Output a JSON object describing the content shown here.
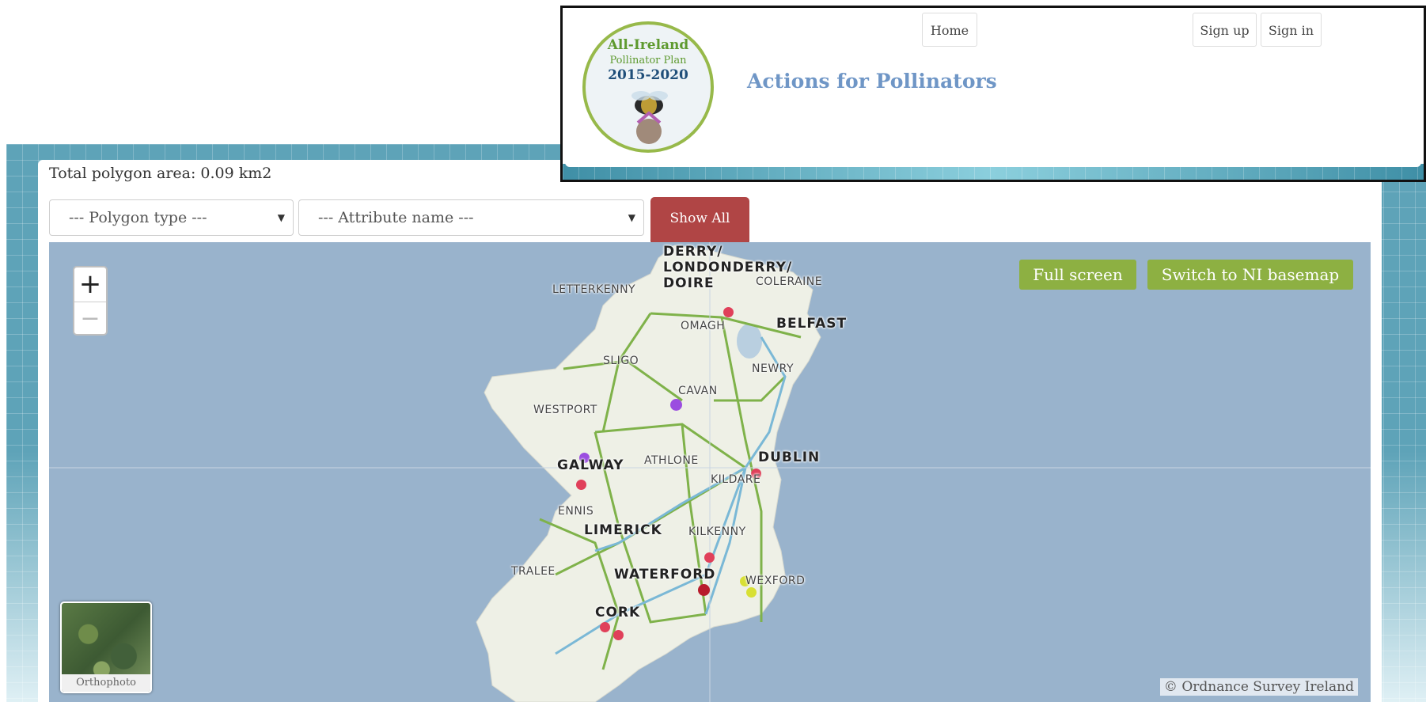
{
  "header": {
    "logo": {
      "line1": "All-Ireland",
      "line2": "Pollinator Plan",
      "line3": "2015-2020"
    },
    "site_title": "Actions for Pollinators",
    "nav": {
      "home": "Home",
      "sign_up": "Sign up",
      "sign_in": "Sign in"
    }
  },
  "toolbar": {
    "area_text": "Total polygon area: 0.09 km2",
    "polygon_type_placeholder": "--- Polygon type ---",
    "attribute_name_placeholder": "--- Attribute name ---",
    "show_all": "Show All"
  },
  "map": {
    "zoom_in": "+",
    "zoom_out": "−",
    "full_screen": "Full screen",
    "switch_basemap": "Switch to NI basemap",
    "orthophoto": "Orthophoto",
    "attribution": "© Ordnance Survey Ireland",
    "cities": {
      "derry": "DERRY/\nLONDONDERRY/\nDOIRE",
      "letterkenny": "LETTERKENNY",
      "coleraine": "COLERAINE",
      "omagh": "OMAGH",
      "belfast": "BELFAST",
      "sligo": "SLIGO",
      "newry": "NEWRY",
      "cavan": "CAVAN",
      "westport": "WESTPORT",
      "galway": "GALWAY",
      "athlone": "ATHLONE",
      "dublin": "DUBLIN",
      "kildare": "KILDARE",
      "ennis": "ENNIS",
      "limerick": "LIMERICK",
      "kilkenny": "KILKENNY",
      "tralee": "TRALEE",
      "waterford": "WATERFORD",
      "wexford": "WEXFORD",
      "cork": "CORK"
    },
    "marker_colors": {
      "red": "#e0405a",
      "purple": "#9b4de0",
      "yellow": "#d8e034",
      "dark_red": "#b81c2c"
    },
    "land_color": "#eef0e6",
    "road_color": "#7fb24a",
    "motorway_color": "#7ab8d6"
  }
}
